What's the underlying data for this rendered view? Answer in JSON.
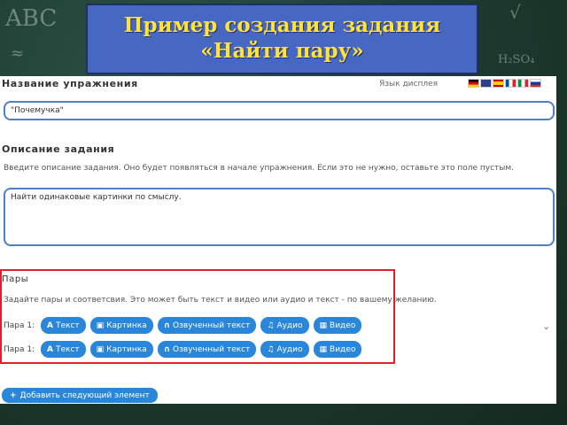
{
  "slide": {
    "title_line1": "Пример создания задания",
    "title_line2": "«Найти пару»"
  },
  "chalkboard": {
    "text1": "ABC",
    "text2": "√",
    "text3": "H₂SO₄",
    "text4": "≈"
  },
  "form": {
    "exercise_name_label": "Название упражнения",
    "display_language_label": "Язык дисплея",
    "exercise_name_value": "\"Почемучка\"",
    "task_description_label": "Описание задания",
    "task_description_hint": "Введите описание задания. Оно будет появляться в начале упражнения. Если это не нужно, оставьте это поле пустым.",
    "task_description_value": "Найти одинаковые картинки по смыслу.",
    "pairs_label": "Пары",
    "pairs_hint": "Задайте пары и соответсвия. Это может быть текст и видео или аудио и текст - по вашему желанию.",
    "pairs": [
      {
        "label": "Пара 1:",
        "buttons": [
          "Текст",
          "Картинка",
          "Озвученный текст",
          "Аудио",
          "Видео"
        ]
      },
      {
        "label": "Пара 1:",
        "buttons": [
          "Текст",
          "Картинка",
          "Озвученный текст",
          "Аудио",
          "Видео"
        ]
      }
    ],
    "add_element_label": "Добавить следующий элемент"
  },
  "colors": {
    "title_bg": "#4768c2",
    "title_text": "#ffe23a",
    "button": "#2a86d8",
    "highlight_frame": "#e01f27"
  },
  "icons": {
    "button_icons": [
      "text-A-icon",
      "image-icon",
      "headphones-icon",
      "music-note-icon",
      "film-icon"
    ],
    "add_icon": "plus-icon",
    "chevron": "chevron-down-icon"
  }
}
